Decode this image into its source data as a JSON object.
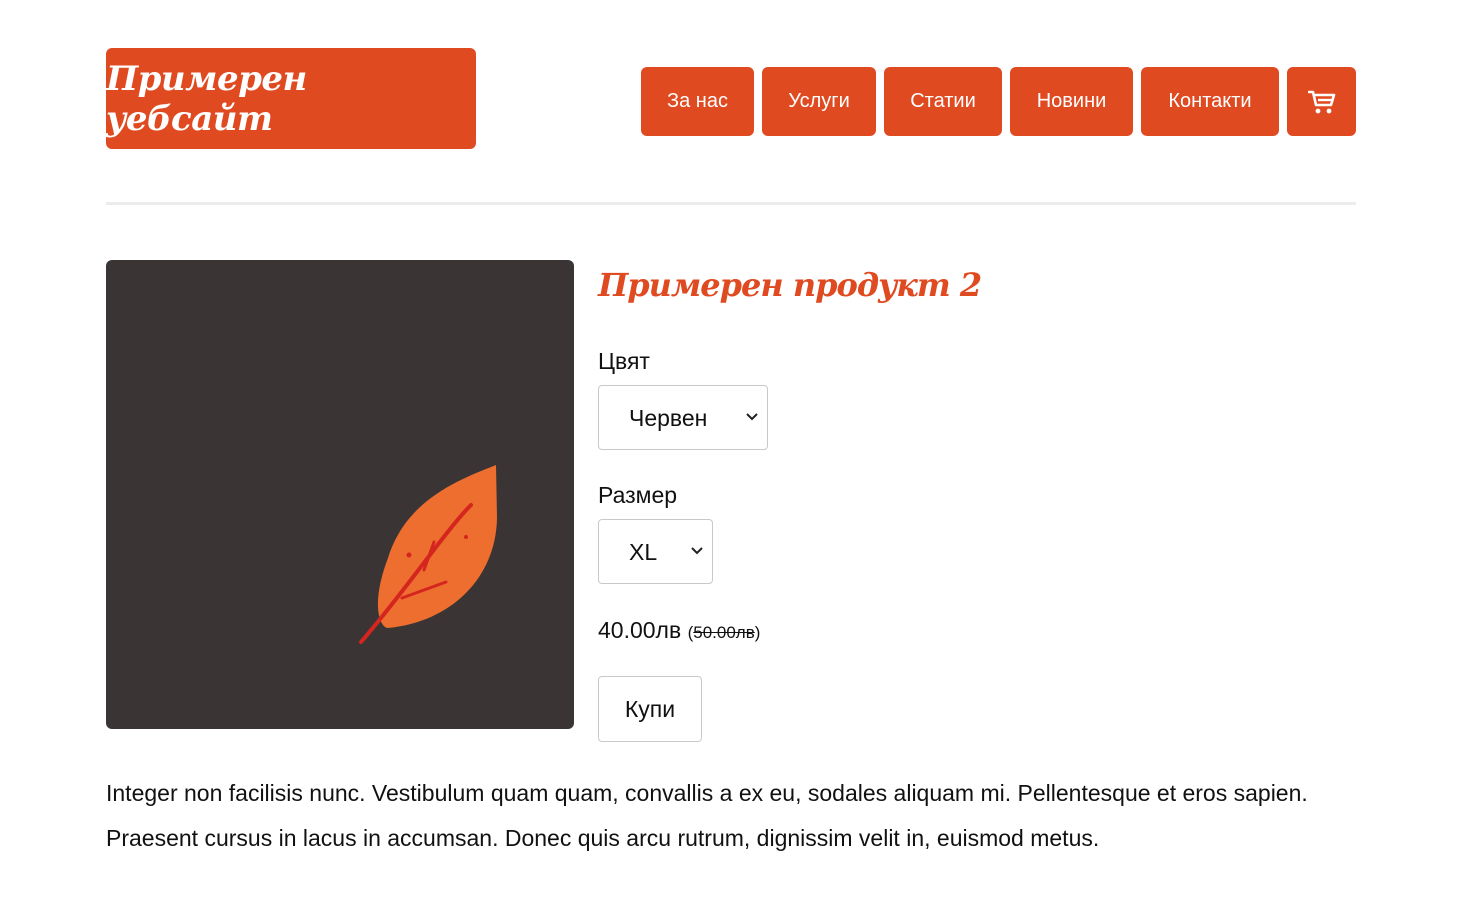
{
  "header": {
    "logo_text": "Примерен уебсайт",
    "nav": [
      {
        "label": "За нас"
      },
      {
        "label": "Услуги"
      },
      {
        "label": "Статии"
      },
      {
        "label": "Новини"
      },
      {
        "label": "Контакти"
      }
    ],
    "cart_icon": "shopping-cart-icon"
  },
  "product": {
    "image_icon": "leaf-icon",
    "title": "Примерен продукт 2",
    "color_label": "Цвят",
    "color_value": "Червен",
    "size_label": "Размер",
    "size_value": "XL",
    "price": "40.00лв",
    "old_price": "50.00лв",
    "buy_label": "Купи"
  },
  "description": "Integer non facilisis nunc. Vestibulum quam quam, convallis a ex eu, sodales aliquam mi. Pellentesque et eros sapien. Praesent cursus in lacus in accumsan. Donec quis arcu rutrum, dignissim velit in, euismod metus.",
  "colors": {
    "accent": "#e04a21",
    "image_bg": "#3a3434",
    "leaf": "#ed6e2e",
    "leaf_vein": "#d4251f"
  }
}
